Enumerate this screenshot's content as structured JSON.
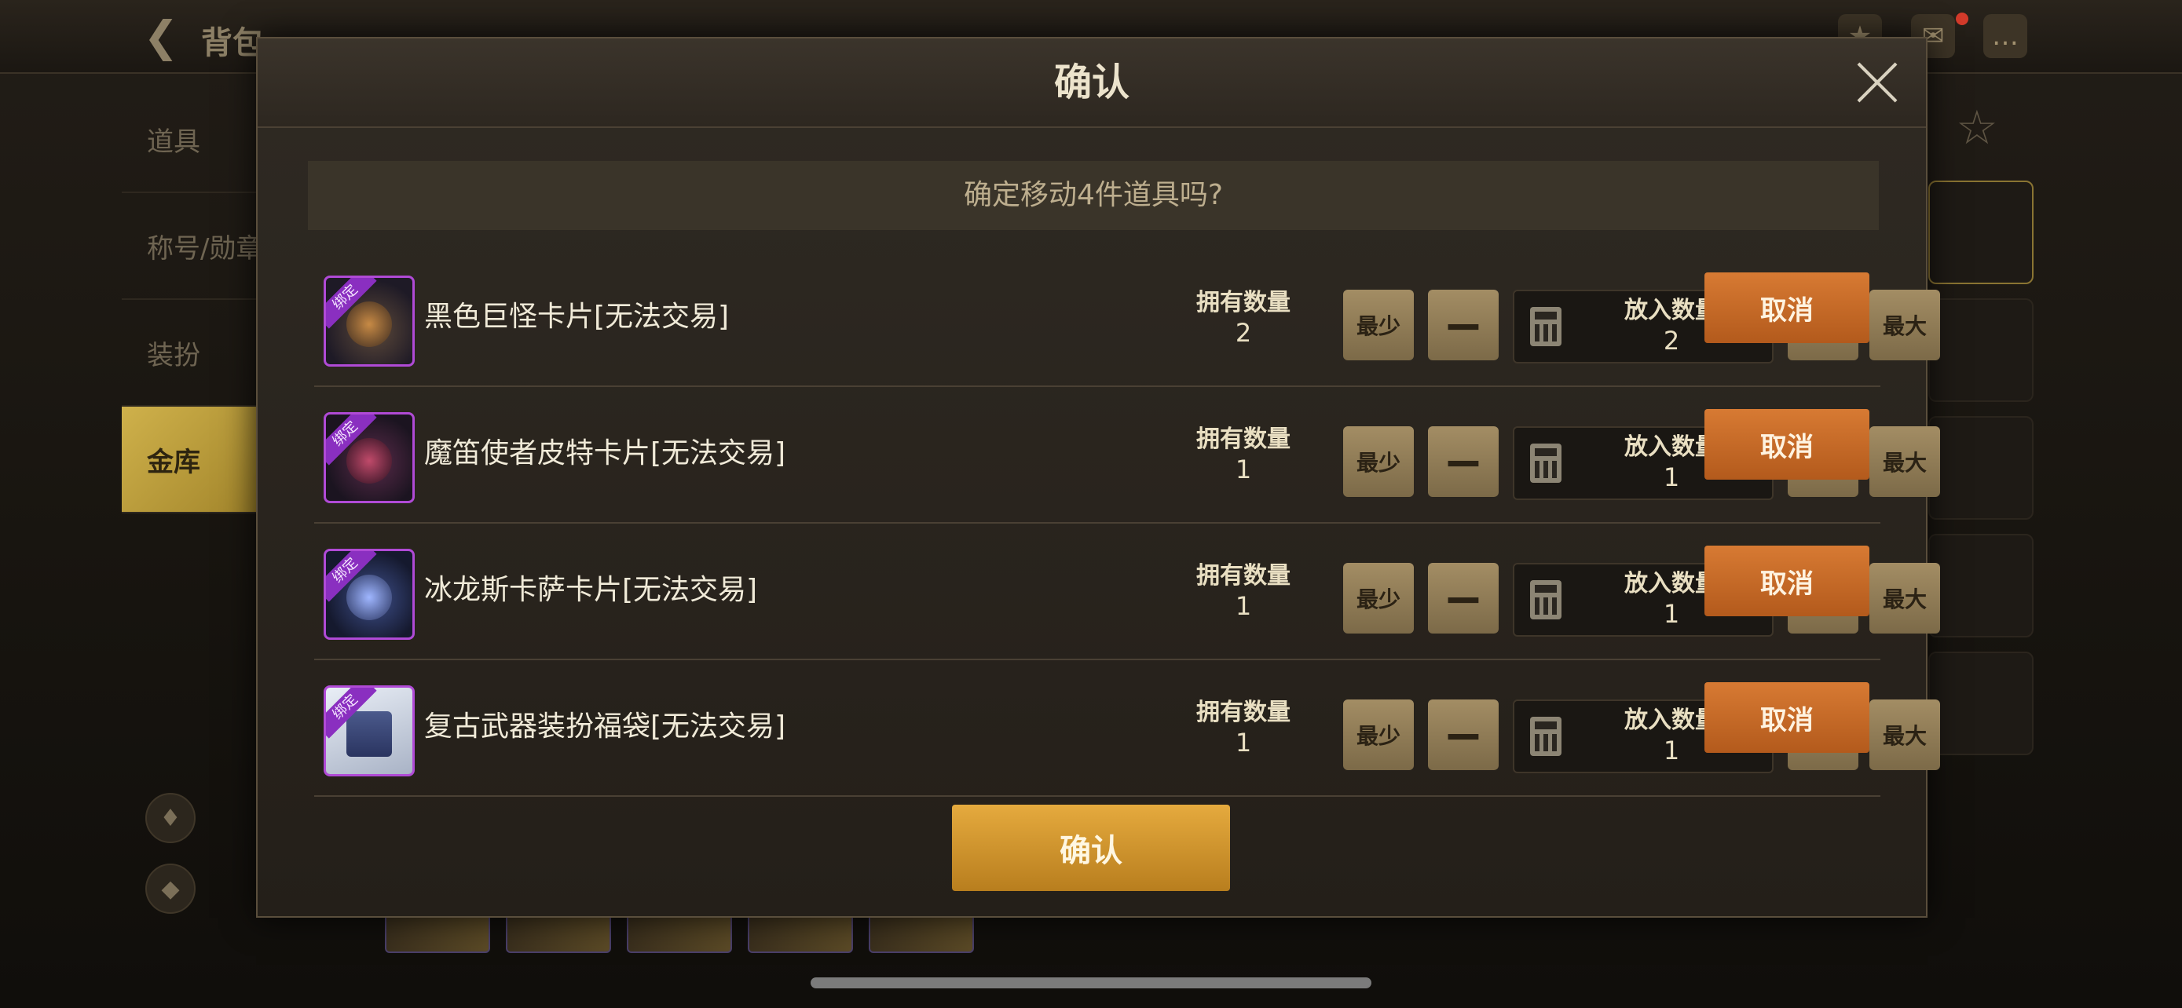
{
  "background": {
    "title": "背包",
    "nav": [
      "道具",
      "称号/勋章",
      "装扮",
      "金库"
    ],
    "active_nav": "金库"
  },
  "dialog": {
    "title": "确认",
    "question": "确定移动4件道具吗?",
    "confirm_label": "确认",
    "items": [
      {
        "bind_tag": "绑定",
        "name": "黑色巨怪卡片[无法交易]",
        "owned_label": "拥有数量",
        "owned": "2",
        "min_label": "最少",
        "put_label": "放入数量",
        "put": "2",
        "max_label": "最大",
        "cancel_label": "取消"
      },
      {
        "bind_tag": "绑定",
        "name": "魔笛使者皮特卡片[无法交易]",
        "owned_label": "拥有数量",
        "owned": "1",
        "min_label": "最少",
        "put_label": "放入数量",
        "put": "1",
        "max_label": "最大",
        "cancel_label": "取消"
      },
      {
        "bind_tag": "绑定",
        "name": "冰龙斯卡萨卡片[无法交易]",
        "owned_label": "拥有数量",
        "owned": "1",
        "min_label": "最少",
        "put_label": "放入数量",
        "put": "1",
        "max_label": "最大",
        "cancel_label": "取消"
      },
      {
        "bind_tag": "绑定",
        "name": "复古武器装扮福袋[无法交易]",
        "owned_label": "拥有数量",
        "owned": "1",
        "min_label": "最少",
        "put_label": "放入数量",
        "put": "1",
        "max_label": "最大",
        "cancel_label": "取消"
      }
    ]
  },
  "colors": {
    "accent": "#c97a2e",
    "confirm": "#d19a35",
    "bind_purple": "#b04ad6"
  }
}
